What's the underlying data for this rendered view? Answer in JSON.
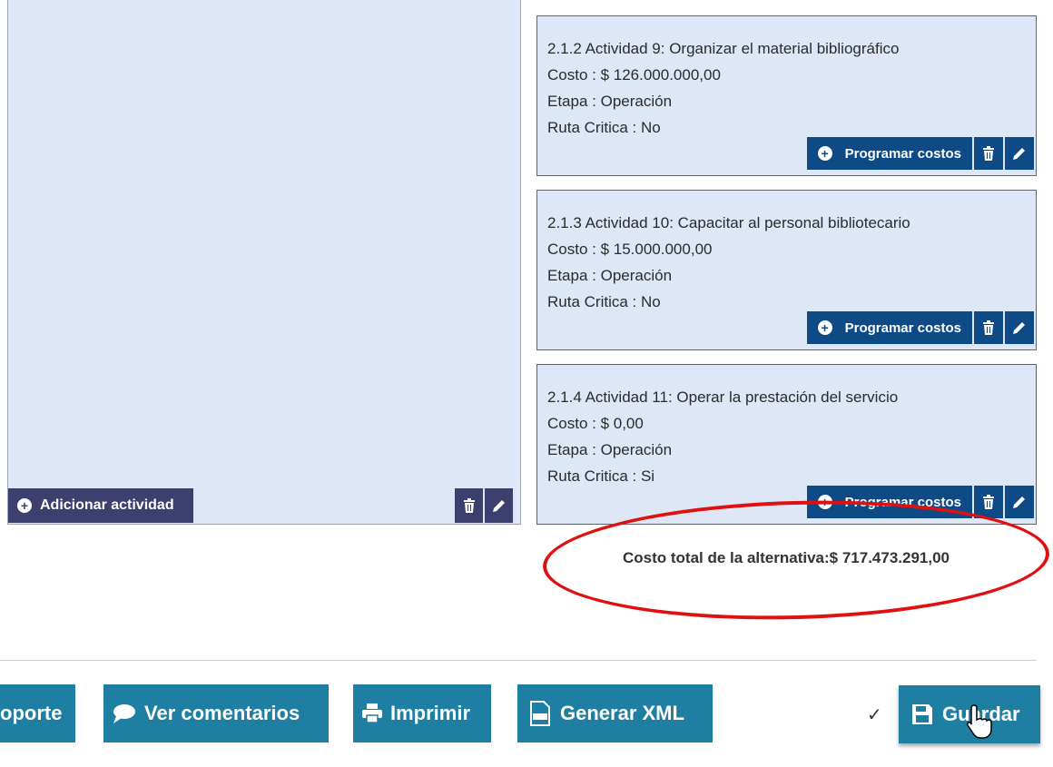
{
  "left_panel": {
    "add_activity_label": "Adicionar actividad"
  },
  "activities": [
    {
      "title": "2.1.2 Actividad 9: Organizar el material bibliográfico",
      "cost": "Costo : $ 126.000.000,00",
      "stage": "Etapa : Operación",
      "critical": "Ruta Critica : No",
      "button_label": "Programar costos"
    },
    {
      "title": "2.1.3 Actividad 10: Capacitar al personal bibliotecario",
      "cost": "Costo : $ 15.000.000,00",
      "stage": "Etapa : Operación",
      "critical": "Ruta Critica : No",
      "button_label": "Programar costos"
    },
    {
      "title": "2.1.4 Actividad 11: Operar la prestación del servicio",
      "cost": "Costo : $ 0,00",
      "stage": "Etapa : Operación",
      "critical": "Ruta Critica : Si",
      "button_label": "Programar costos"
    }
  ],
  "total_cost": "Costo total de la alternativa:$ 717.473.291,00",
  "toolbar": {
    "soporte_label": "oporte",
    "comments_label": "Ver comentarios",
    "print_label": "Imprimir",
    "xml_label": "Generar XML",
    "save_label": "Guardar",
    "check_mark": "✓"
  },
  "colors": {
    "card_bg": "#dde7f6",
    "card_button": "#0d4a86",
    "left_button": "#3d3f6e",
    "toolbar_button": "#1f7fa3",
    "highlight_ellipse": "#e01010",
    "critical_border": "#c0392b"
  }
}
